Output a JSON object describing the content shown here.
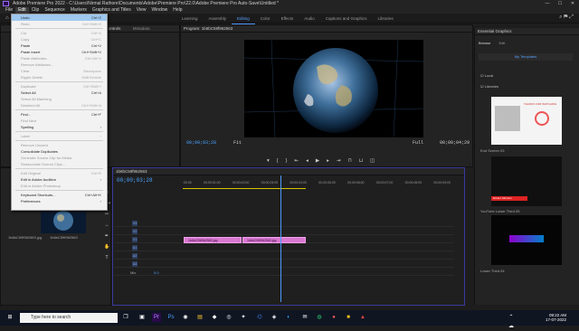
{
  "window": {
    "title": "Adobe Premiere Pro 2022 - C:\\Users\\Nirmal Rathore\\Documents\\Adobe\\Premiere Pro\\22.0\\Adobe Premiere Pro Auto-Save\\Untitled *",
    "minimize": "—",
    "maximize": "☐",
    "close": "✕"
  },
  "menubar": [
    "File",
    "Edit",
    "Clip",
    "Sequence",
    "Markers",
    "Graphics and Titles",
    "View",
    "Window",
    "Help"
  ],
  "workspaces": [
    "Learning",
    "Assembly",
    "Editing",
    "Color",
    "Effects",
    "Audio",
    "Captions and Graphics",
    "Libraries"
  ],
  "active_workspace": "Editing",
  "edit_menu": [
    {
      "label": "Undo",
      "shortcut": "Ctrl+Z",
      "disabled": false,
      "highlight": true
    },
    {
      "label": "Redo",
      "shortcut": "Ctrl+Shift+Z",
      "disabled": true
    },
    {
      "sep": true
    },
    {
      "label": "Cut",
      "shortcut": "Ctrl+X",
      "disabled": true
    },
    {
      "label": "Copy",
      "shortcut": "Ctrl+C",
      "disabled": true
    },
    {
      "label": "Paste",
      "shortcut": "Ctrl+V",
      "disabled": false
    },
    {
      "label": "Paste Insert",
      "shortcut": "Ctrl+Shift+V",
      "disabled": false
    },
    {
      "label": "Paste Attributes...",
      "shortcut": "Ctrl+Alt+V",
      "disabled": true
    },
    {
      "label": "Remove Attributes...",
      "shortcut": "",
      "disabled": true
    },
    {
      "label": "Clear",
      "shortcut": "Backspace",
      "disabled": true
    },
    {
      "label": "Ripple Delete",
      "shortcut": "Shift+Delete",
      "disabled": true
    },
    {
      "sep": true
    },
    {
      "label": "Duplicate",
      "shortcut": "Ctrl+Shift+/",
      "disabled": true
    },
    {
      "label": "Select All",
      "shortcut": "Ctrl+A",
      "disabled": false
    },
    {
      "label": "Select All Matching",
      "shortcut": "",
      "disabled": true
    },
    {
      "label": "Deselect All",
      "shortcut": "Ctrl+Shift+A",
      "disabled": true
    },
    {
      "sep": true
    },
    {
      "label": "Find...",
      "shortcut": "Ctrl+F",
      "disabled": false
    },
    {
      "label": "Find Next",
      "shortcut": "",
      "disabled": true
    },
    {
      "label": "Spelling",
      "shortcut": "›",
      "disabled": false
    },
    {
      "sep": true
    },
    {
      "label": "Label",
      "shortcut": "›",
      "disabled": true
    },
    {
      "sep": true
    },
    {
      "label": "Remove Unused",
      "shortcut": "",
      "disabled": true
    },
    {
      "label": "Consolidate Duplicates",
      "shortcut": "",
      "disabled": false
    },
    {
      "label": "Generate Source Clip for Media",
      "shortcut": "",
      "disabled": true
    },
    {
      "label": "Reassociate Source Clips...",
      "shortcut": "",
      "disabled": true
    },
    {
      "sep": true
    },
    {
      "label": "Edit Original",
      "shortcut": "Ctrl+E",
      "disabled": true
    },
    {
      "label": "Edit in Adobe Audition",
      "shortcut": "›",
      "disabled": false
    },
    {
      "label": "Edit in Adobe Photoshop",
      "shortcut": "",
      "disabled": true
    },
    {
      "sep": true
    },
    {
      "label": "Keyboard Shortcuts...",
      "shortcut": "Ctrl+Alt+K",
      "disabled": false
    },
    {
      "label": "Preferences",
      "shortcut": "›",
      "disabled": false
    }
  ],
  "source_panel": {
    "tab": "Effect Controls",
    "tab2": "Metadata"
  },
  "program": {
    "title": "Program: 1b6bC59f962563",
    "timecode": "00;00;03;28",
    "fit": "Fit",
    "quality": "Full",
    "duration": "00;00;04;29"
  },
  "project": {
    "bin_label": "1b6bC59f962563.jpg",
    "bin_label2": "1b6bC59f962563"
  },
  "timeline": {
    "tab": "1b6bC59f962563",
    "timecode": "00;00;03;28",
    "ruler": [
      ":00;00",
      "00;00;01;00",
      "00;00;02;00",
      "00;00;03;00",
      "00;00;04;00",
      "00;00;05;00",
      "00;00;06;00",
      "00;00;07;00",
      "00;00;08;00",
      "00;00;09;00"
    ],
    "tracks": [
      "V3",
      "V2",
      "V1",
      "A1",
      "A2",
      "A3",
      "Mix"
    ],
    "mix_value": "0.0",
    "clip1": "1b6bC59f962563.jpg",
    "clip2": "1b6bC59f962563.jpg"
  },
  "essential_graphics": {
    "title": "Essential Graphics",
    "tab_browse": "Browse",
    "tab_edit": "Edit",
    "my_templates": "My Templates",
    "local": "Local",
    "libraries": "Libraries",
    "item1": "End Screen 03",
    "item1_text": "THANKS FOR WATCHING",
    "item2": "YouTube Lower Third 05",
    "item2_text": "Daniel Johnson",
    "item3": "Lower Third 04"
  },
  "taskbar": {
    "search_placeholder": "Type here to search",
    "time": "09:22 AM",
    "date": "17-07-2022"
  },
  "colors": {
    "accent": "#4aa3ff",
    "clip": "#d878d0",
    "menu_bg": "#f2f2f2",
    "highlight": "#9ec8ef"
  }
}
